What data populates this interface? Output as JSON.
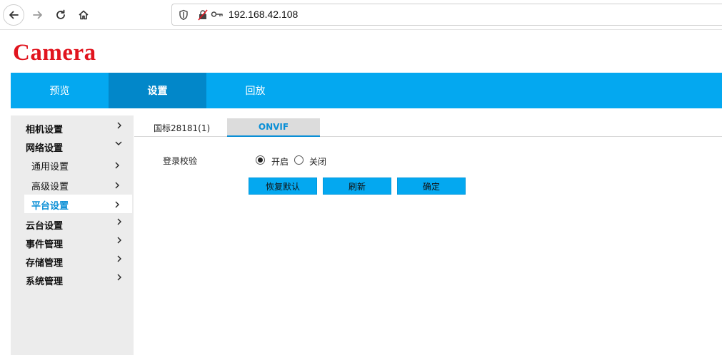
{
  "browser": {
    "url": "192.168.42.108",
    "icons": [
      "back-arrow-icon",
      "forward-arrow-icon",
      "reload-icon",
      "home-icon",
      "shield-icon",
      "insecure-lock-icon",
      "key-icon"
    ]
  },
  "logo": {
    "text": "Camera",
    "color": "#e1141e"
  },
  "main_nav": {
    "accent": "#04a8f0",
    "active_color": "#0287c9",
    "tabs": [
      {
        "label": "预览",
        "active": false
      },
      {
        "label": "设置",
        "active": true
      },
      {
        "label": "回放",
        "active": false
      }
    ]
  },
  "sidebar": {
    "items": [
      {
        "label": "相机设置",
        "level": 1,
        "expanded": false,
        "active": false
      },
      {
        "label": "网络设置",
        "level": 1,
        "expanded": true,
        "active": false
      },
      {
        "label": "通用设置",
        "level": 2,
        "active": false
      },
      {
        "label": "高级设置",
        "level": 2,
        "active": false
      },
      {
        "label": "平台设置",
        "level": 2,
        "active": true
      },
      {
        "label": "云台设置",
        "level": 1,
        "expanded": false,
        "active": false
      },
      {
        "label": "事件管理",
        "level": 1,
        "expanded": false,
        "active": false
      },
      {
        "label": "存储管理",
        "level": 1,
        "expanded": false,
        "active": false
      },
      {
        "label": "系统管理",
        "level": 1,
        "expanded": false,
        "active": false
      }
    ]
  },
  "sub_tabs": [
    {
      "label": "国标28181(1)",
      "active": false
    },
    {
      "label": "ONVIF",
      "active": true
    }
  ],
  "form": {
    "login_check": {
      "label": "登录校验",
      "options": [
        {
          "label": "开启",
          "checked": true
        },
        {
          "label": "关闭",
          "checked": false
        }
      ]
    },
    "buttons": {
      "restore_default": "恢复默认",
      "refresh": "刷新",
      "confirm": "确定"
    }
  }
}
